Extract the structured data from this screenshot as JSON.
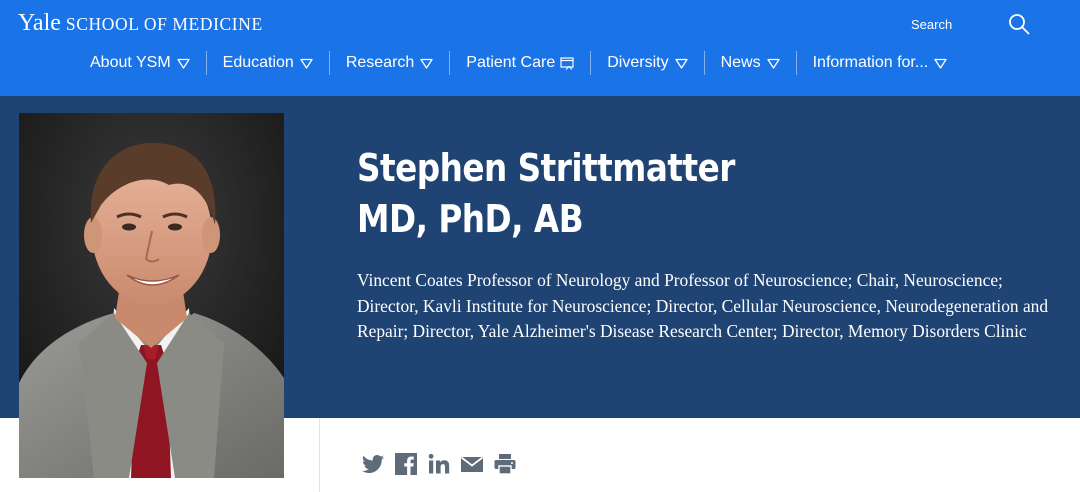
{
  "header": {
    "logo_yale": "Yale",
    "logo_school": "SCHOOL OF MEDICINE",
    "search_label": "Search",
    "brand_color": "#1a74e8"
  },
  "nav": {
    "items": [
      {
        "label": "About YSM",
        "icon": "caret-down-icon"
      },
      {
        "label": "Education",
        "icon": "caret-down-icon"
      },
      {
        "label": "Research",
        "icon": "caret-down-icon"
      },
      {
        "label": "Patient Care",
        "icon": "external-link-icon"
      },
      {
        "label": "Diversity",
        "icon": "caret-down-icon"
      },
      {
        "label": "News",
        "icon": "caret-down-icon"
      },
      {
        "label": "Information for...",
        "icon": "caret-down-icon"
      }
    ]
  },
  "profile": {
    "name_line1": "Stephen Strittmatter",
    "name_line2": "MD, PhD, AB",
    "titles": "Vincent Coates Professor of Neurology and Professor of Neuroscience; Chair, Neuroscience; Director, Kavli Institute for Neuroscience; Director, Cellular Neuroscience, Neurodegeneration and Repair; Director, Yale Alzheimer's Disease Research Center; Director, Memory Disorders Clinic",
    "hero_color": "#1f4474"
  },
  "share": {
    "icons": [
      "twitter-icon",
      "facebook-icon",
      "linkedin-icon",
      "email-icon",
      "print-icon"
    ],
    "icon_color": "#5e6b78"
  }
}
